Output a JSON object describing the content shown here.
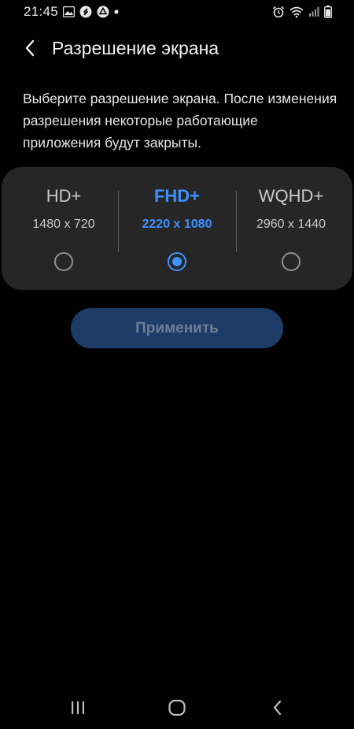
{
  "status_bar": {
    "time": "21:45",
    "left_icons": [
      "image-icon",
      "shazam-icon",
      "drive-icon",
      "dot-icon"
    ],
    "right_icons": [
      "alarm-icon",
      "wifi-icon",
      "signal-icon",
      "battery-icon"
    ]
  },
  "header": {
    "back_icon": "chevron-left-icon",
    "title": "Разрешение экрана"
  },
  "description": "Выберите разрешение экрана. После изменения разрешения некоторые работающие приложения будут закрыты.",
  "resolution_options": [
    {
      "name": "HD+",
      "size": "1480 x 720",
      "selected": false
    },
    {
      "name": "FHD+",
      "size": "2220 x 1080",
      "selected": true
    },
    {
      "name": "WQHD+",
      "size": "2960 x 1440",
      "selected": false
    }
  ],
  "apply_button": {
    "label": "Применить",
    "enabled": false
  },
  "nav_bar": {
    "icons": [
      "recent-apps-icon",
      "home-icon",
      "back-icon"
    ]
  },
  "colors": {
    "accent": "#3e91ff",
    "card_background": "#262626",
    "apply_button_background": "#1d3c68",
    "apply_button_text": "#6f7d92",
    "background": "#000000"
  }
}
